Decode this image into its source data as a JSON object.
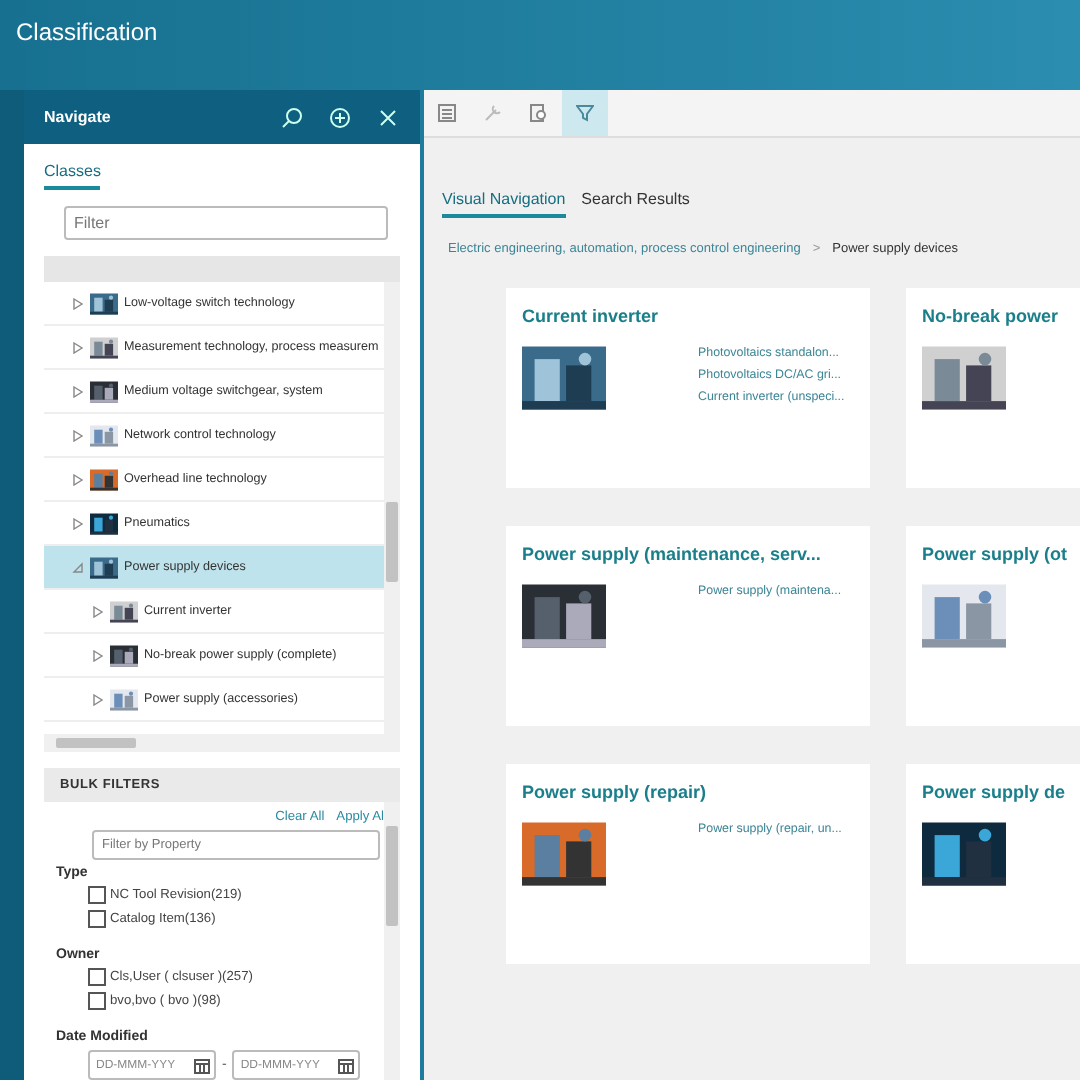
{
  "app_title": "Classification",
  "navigate": {
    "title": "Navigate",
    "tab": "Classes",
    "filter_placeholder": "Filter",
    "tree": [
      {
        "label": "Low-voltage switch technology",
        "expanded": false,
        "selected": false
      },
      {
        "label": "Measurement technology, process measurem",
        "expanded": false,
        "selected": false
      },
      {
        "label": "Medium voltage switchgear, system",
        "expanded": false,
        "selected": false
      },
      {
        "label": "Network control technology",
        "expanded": false,
        "selected": false
      },
      {
        "label": "Overhead line technology",
        "expanded": false,
        "selected": false
      },
      {
        "label": "Pneumatics",
        "expanded": false,
        "selected": false
      },
      {
        "label": "Power supply devices",
        "expanded": true,
        "selected": true,
        "children": [
          {
            "label": "Current inverter",
            "expanded": false,
            "selected": false
          },
          {
            "label": "No-break power supply (complete)",
            "expanded": false,
            "selected": false
          },
          {
            "label": "Power supply (accessories)",
            "expanded": false,
            "selected": false
          }
        ]
      }
    ]
  },
  "bulk_filters": {
    "title": "BULK FILTERS",
    "clear_all": "Clear All",
    "apply_all": "Apply Al",
    "filter_placeholder": "Filter by Property",
    "groups": [
      {
        "kind": "checks",
        "title": "Type",
        "options": [
          {
            "label": "NC Tool Revision(219)",
            "checked": false
          },
          {
            "label": "Catalog Item(136)",
            "checked": false
          }
        ]
      },
      {
        "kind": "checks",
        "title": "Owner",
        "options": [
          {
            "label": "Cls,User ( clsuser )(257)",
            "checked": false
          },
          {
            "label": "bvo,bvo ( bvo )(98)",
            "checked": false
          }
        ]
      },
      {
        "kind": "dates",
        "title": "Date Modified",
        "from_placeholder": "DD-MMM-YYY",
        "separator": "-",
        "to_placeholder": "DD-MMM-YYY"
      }
    ]
  },
  "toolbar": [
    {
      "selected": false
    },
    {
      "selected": false
    },
    {
      "selected": false
    },
    {
      "selected": true
    }
  ],
  "tabs": [
    {
      "label": "Visual Navigation",
      "selected": true
    },
    {
      "label": "Search Results",
      "selected": false
    }
  ],
  "breadcrumb": {
    "path": "Electric engineering, automation, process control engineering",
    "separator": ">",
    "current": "Power supply devices"
  },
  "cards": [
    {
      "title": "Current inverter",
      "links": [
        "Photovoltaics standalon...",
        "Photovoltaics DC/AC gri...",
        "Current inverter (unspeci..."
      ]
    },
    {
      "title": "No-break power"
    },
    {
      "title": "Power supply (maintenance, serv...",
      "links": [
        "Power supply (maintena..."
      ]
    },
    {
      "title": "Power supply (ot"
    },
    {
      "title": "Power supply (repair)",
      "links": [
        "Power supply (repair, un..."
      ]
    },
    {
      "title": "Power supply de"
    }
  ]
}
